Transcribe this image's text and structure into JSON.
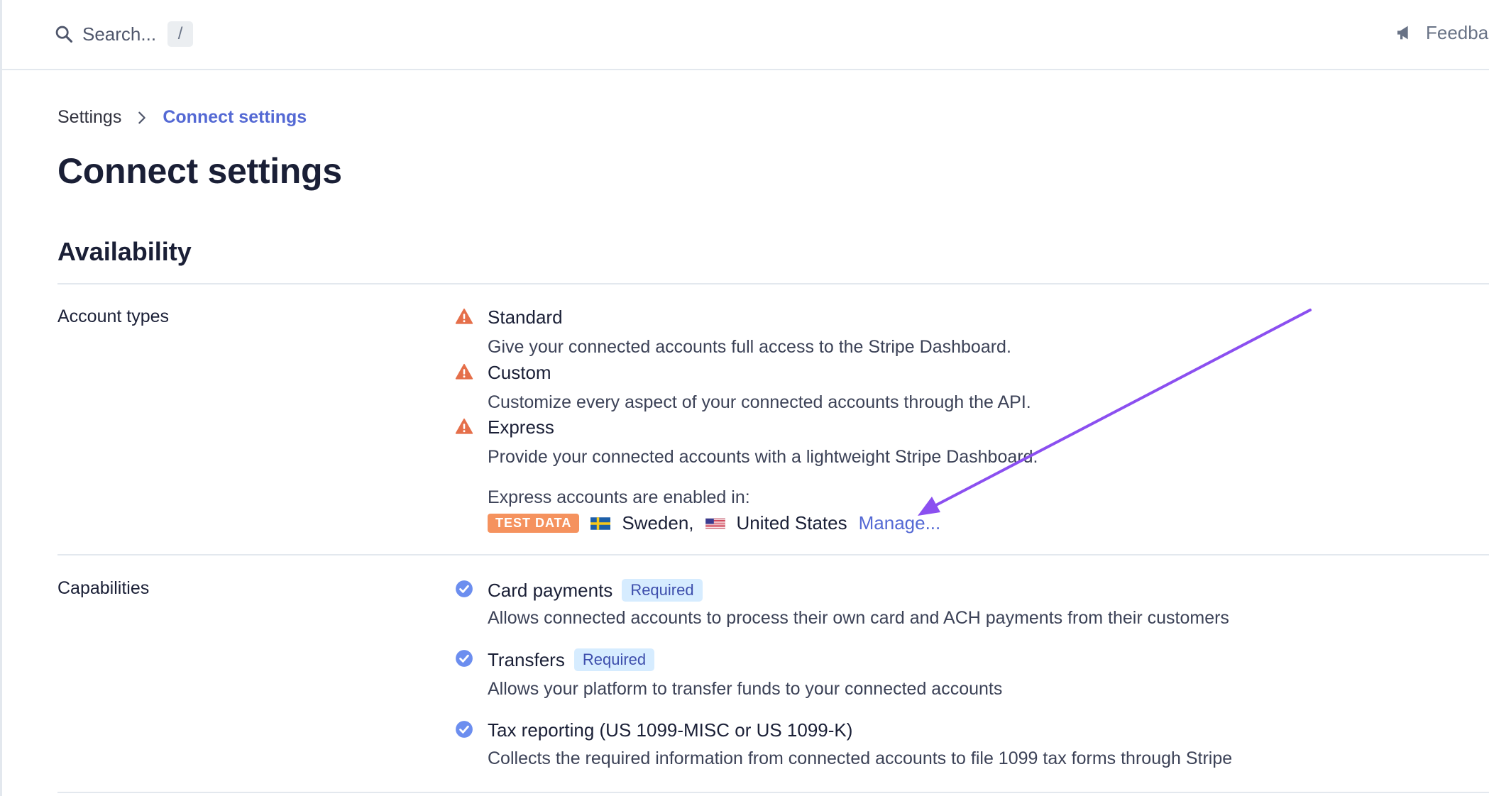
{
  "topbar": {
    "search_placeholder": "Search...",
    "search_shortcut": "/",
    "feedback_label": "Feedba"
  },
  "breadcrumb": {
    "parent": "Settings",
    "current": "Connect settings"
  },
  "page_title": "Connect settings",
  "section_title": "Availability",
  "account_types": {
    "label": "Account types",
    "items": [
      {
        "title": "Standard",
        "description": "Give your connected accounts full access to the Stripe Dashboard.",
        "icon": "warning-icon"
      },
      {
        "title": "Custom",
        "description": "Customize every aspect of your connected accounts through the API.",
        "icon": "warning-icon"
      },
      {
        "title": "Express",
        "description": "Provide your connected accounts with a lightweight Stripe Dashboard.",
        "icon": "warning-icon"
      }
    ],
    "express_note": "Express accounts are enabled in:",
    "test_badge": "TEST DATA",
    "countries": [
      "Sweden,",
      "United States"
    ],
    "manage_label": "Manage..."
  },
  "capabilities": {
    "label": "Capabilities",
    "items": [
      {
        "title": "Card payments",
        "badge": "Required",
        "description": "Allows connected accounts to process their own card and ACH payments from their customers",
        "icon": "check-circle-icon"
      },
      {
        "title": "Transfers",
        "badge": "Required",
        "description": "Allows your platform to transfer funds to your connected accounts",
        "icon": "check-circle-icon"
      },
      {
        "title": "Tax reporting (US 1099-MISC or US 1099-K)",
        "description": "Collects the required information from connected accounts to file 1099 tax forms through Stripe",
        "icon": "check-circle-icon"
      }
    ]
  },
  "colors": {
    "accent": "#5469d4",
    "warning": "#e56f4a",
    "check": "#6c8eef",
    "annotation_arrow": "#8b4ff0",
    "test_badge": "#f5925e"
  }
}
